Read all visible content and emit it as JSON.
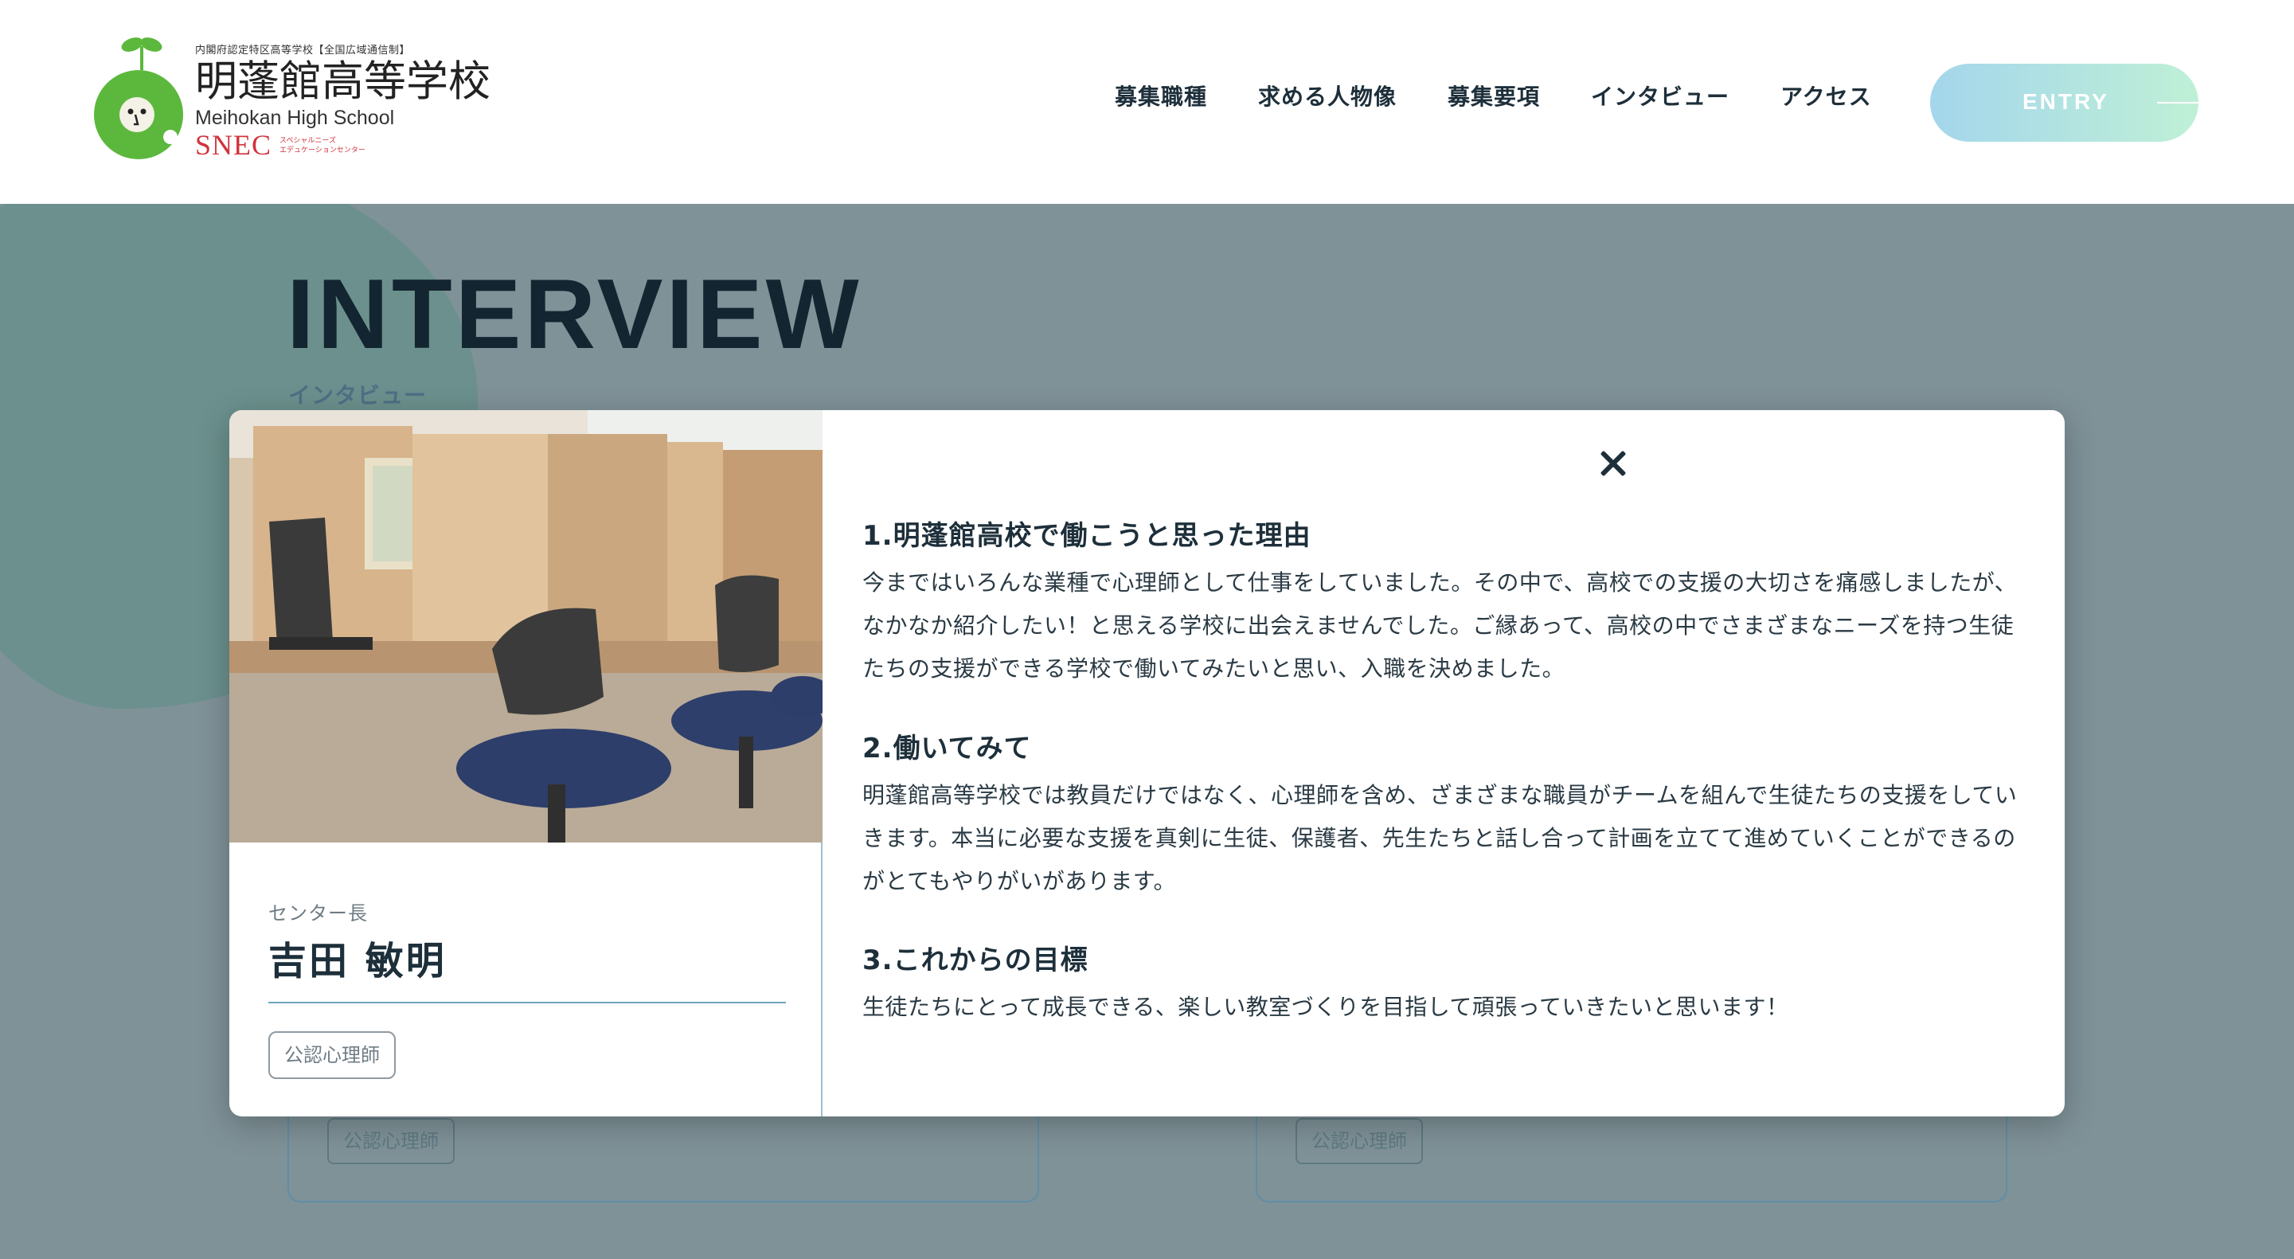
{
  "header": {
    "logo": {
      "sub": "内閣府認定特区高等学校【全国広域通信制】",
      "main": "明蓬館高等学校",
      "en": "Meihokan High School",
      "snec": "SNEC",
      "snec_ja_1": "スペシャルニーズ",
      "snec_ja_2": "エデュケーションセンター"
    },
    "nav": [
      "募集職種",
      "求める人物像",
      "募集要項",
      "インタビュー",
      "アクセス"
    ],
    "entry_label": "ENTRY"
  },
  "background": {
    "title": "INTERVIEW",
    "subtitle": "インタビュー",
    "card_tags": [
      "公認心理師",
      "公認心理師"
    ]
  },
  "modal": {
    "role": "センター長",
    "name": "吉田 敏明",
    "tag": "公認心理師",
    "sections": [
      {
        "heading": "1.明蓬館高校で働こうと思った理由",
        "body": "今まではいろんな業種で心理師として仕事をしていました。その中で、高校での支援の大切さを痛感しましたが、なかなか紹介したい！と思える学校に出会えませんでした。ご縁あって、高校の中でさまざまなニーズを持つ生徒たちの支援ができる学校で働いてみたいと思い、入職を決めました。"
      },
      {
        "heading": "2.働いてみて",
        "body": "明蓬館高等学校では教員だけではなく、心理師を含め、ざまざまな職員がチームを組んで生徒たちの支援をしていきます。本当に必要な支援を真剣に生徒、保護者、先生たちと話し合って計画を立てて進めていくことができるのがとてもやりがいがあります。"
      },
      {
        "heading": "3.これからの目標",
        "body": "生徒たちにとって成長できる、楽しい教室づくりを目指して頑張っていきたいと思います！"
      }
    ]
  },
  "colors": {
    "overlay": "#7f9298",
    "accent": "#6fa5bd",
    "entry_gradient_start": "#a4d6ec",
    "entry_gradient_end": "#bff0d6",
    "logo_green": "#5cb83c",
    "snec_red": "#d1333d"
  }
}
